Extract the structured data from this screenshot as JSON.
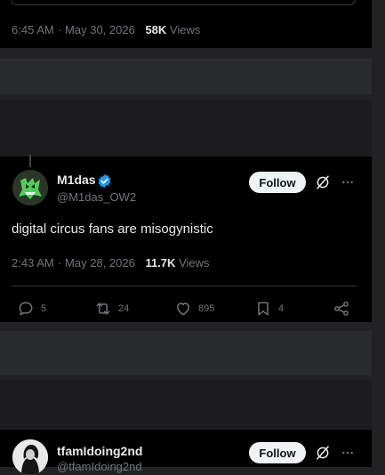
{
  "top_post": {
    "time": "6:45 AM",
    "separator": "·",
    "date": "May 30, 2026",
    "views_count": "58K",
    "views_label": "Views"
  },
  "main_post": {
    "author_name": "M1das",
    "author_handle": "@M1das_OW2",
    "follow_label": "Follow",
    "text": "digital circus fans are misogynistic",
    "time": "2:43 AM",
    "separator": "·",
    "date": "May 28, 2026",
    "views_count": "11.7K",
    "views_label": "Views",
    "actions": {
      "replies": "5",
      "reposts": "24",
      "likes": "895",
      "bookmarks": "4"
    }
  },
  "bottom_post": {
    "author_name": "tfamIdoing2nd",
    "author_handle": "@tfamIdoing2nd",
    "follow_label": "Follow"
  },
  "icons": {
    "verified": "verified-badge-icon",
    "grok": "grok-icon",
    "more": "more-icon",
    "reply": "reply-icon",
    "repost": "repost-icon",
    "like": "like-icon",
    "bookmark": "bookmark-icon",
    "share": "share-icon"
  },
  "colors": {
    "card_background": "#000000",
    "page_background": "#222224",
    "verified_blue": "#1d9bf0",
    "secondary_text": "#71767b",
    "primary_text": "#e7e9ea",
    "follow_button": "#eff3f4"
  }
}
